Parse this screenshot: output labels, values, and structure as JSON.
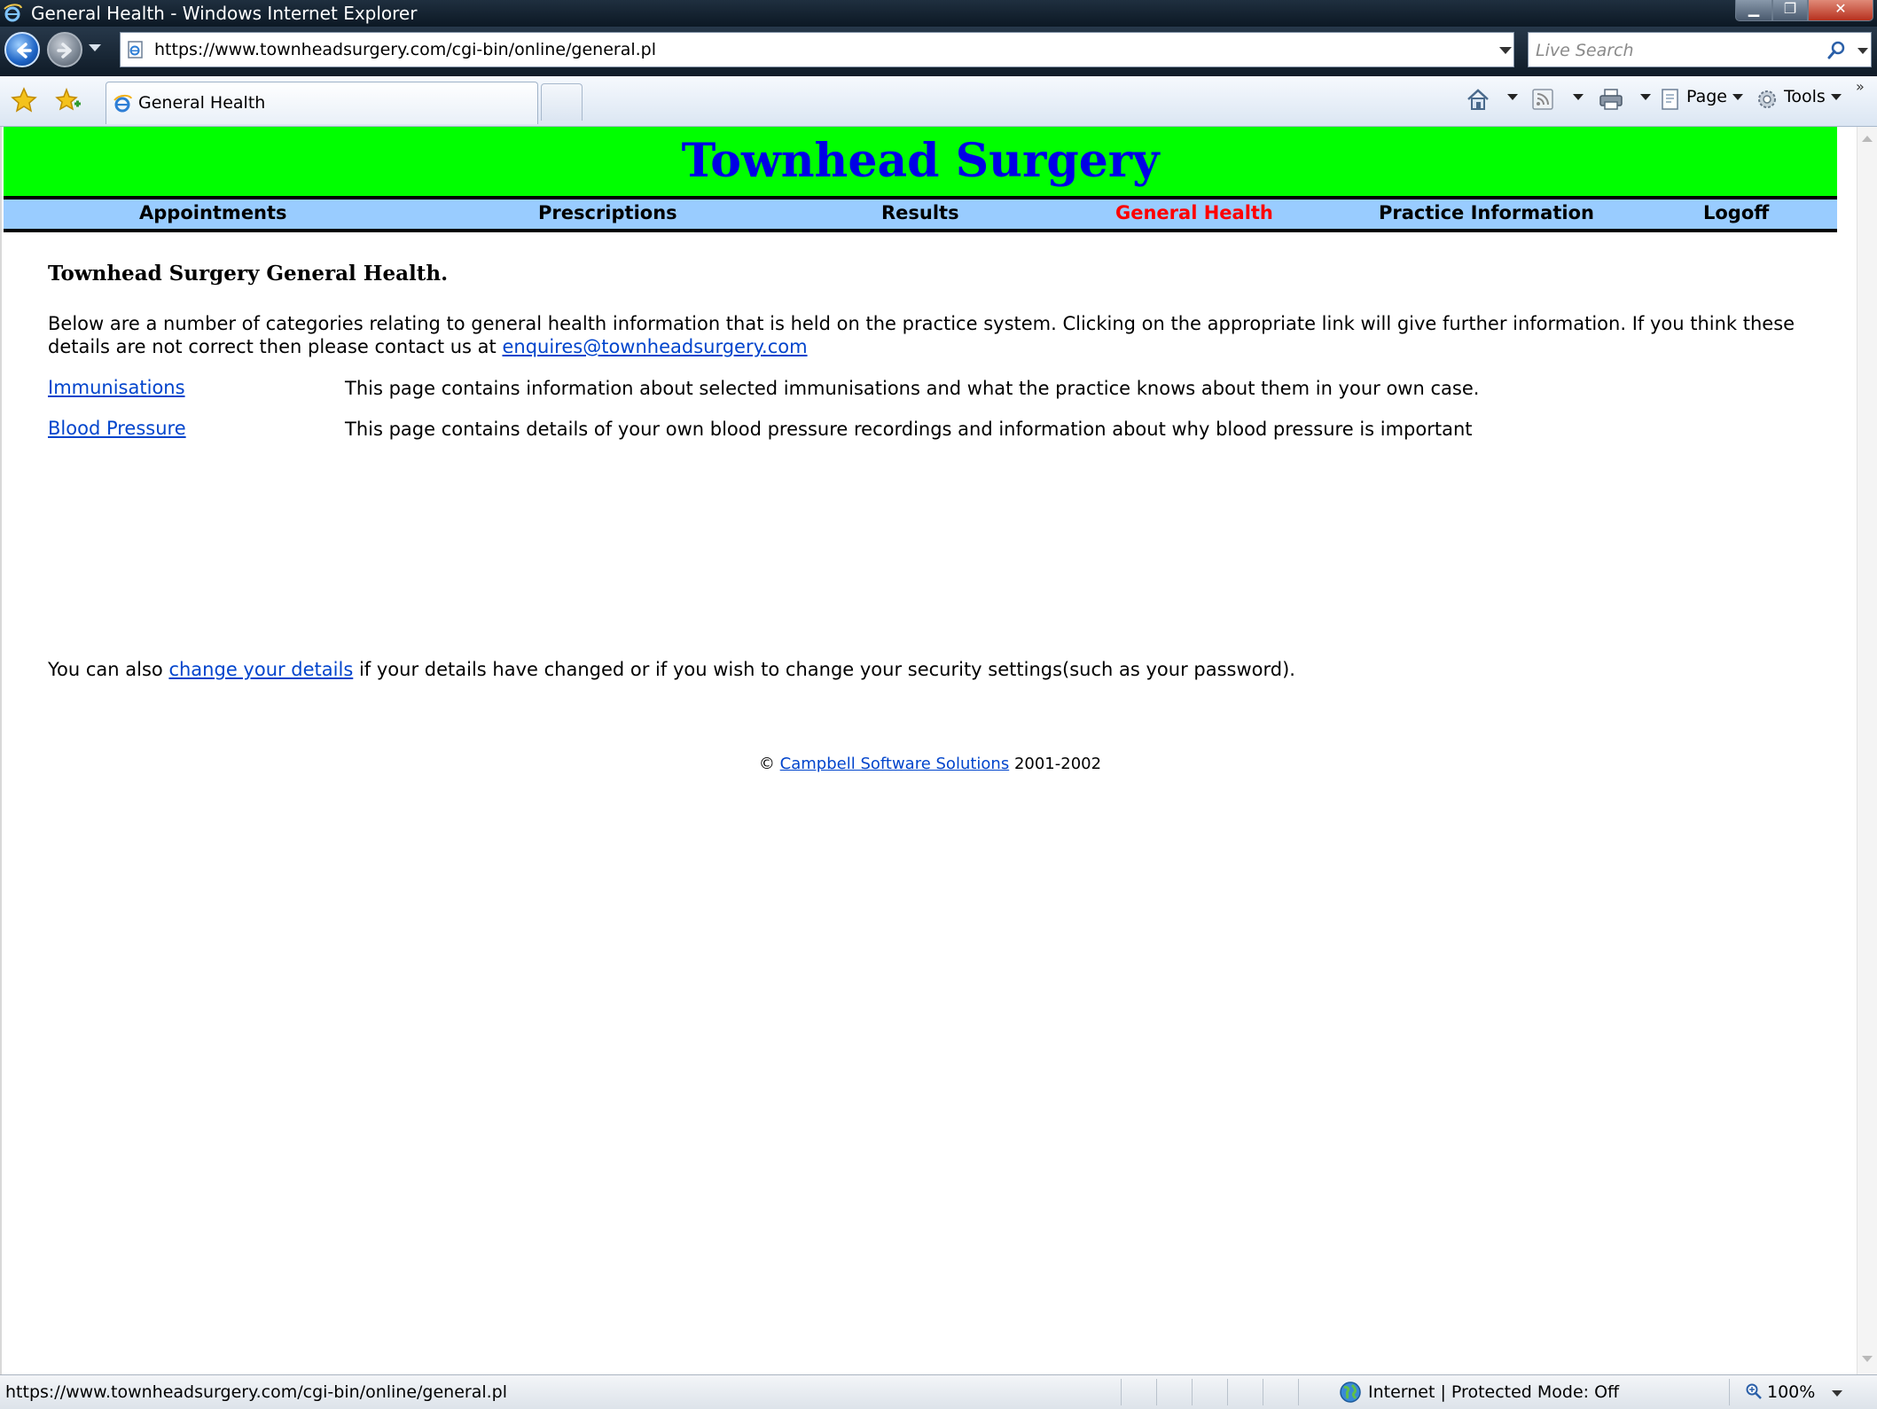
{
  "window": {
    "title": "General Health - Windows Internet Explorer",
    "minimize": "▁",
    "maximize": "❐",
    "close": "✕"
  },
  "address": {
    "url": "https://www.townheadsurgery.com/cgi-bin/online/general.pl"
  },
  "search": {
    "placeholder": "Live Search"
  },
  "tab": {
    "label": "General Health"
  },
  "commands": {
    "page": "Page",
    "tools": "Tools",
    "more": "»"
  },
  "site": {
    "title": "Townhead Surgery",
    "nav": [
      {
        "label": "Appointments",
        "active": false
      },
      {
        "label": "Prescriptions",
        "active": false
      },
      {
        "label": "Results",
        "active": false
      },
      {
        "label": "General Health",
        "active": true
      },
      {
        "label": "Practice Information",
        "active": false
      },
      {
        "label": "Logoff",
        "active": false
      }
    ],
    "colors": {
      "header_bg": "#00ff00",
      "title": "#0000e6",
      "nav_bg": "#99ccff",
      "nav_active": "#ff0000"
    }
  },
  "content": {
    "heading": "Townhead Surgery General Health.",
    "intro": "Below are a number of categories relating to general health information that is held on the practice system. Clicking on the appropriate link will give further information. If you think these details are not correct then please contact us at",
    "email": "enquires@townheadsurgery.com",
    "categories": [
      {
        "label": "Immunisations",
        "description": "This page contains information about selected immunisations and what the practice knows about them in your own case."
      },
      {
        "label": "Blood Pressure",
        "description": "This page contains details of your own blood pressure recordings and information about why blood pressure is important"
      }
    ],
    "also_prefix": "You can also",
    "also_link": "change your details",
    "also_suffix": "if your details have changed or if you wish to change your security settings(such as your password)."
  },
  "footer": {
    "copyright": "©",
    "company": "Campbell Software Solutions",
    "years": "2001-2002"
  },
  "status": {
    "text": "https://www.townheadsurgery.com/cgi-bin/online/general.pl",
    "zone": "Internet | Protected Mode: Off",
    "zoom": "100%"
  }
}
